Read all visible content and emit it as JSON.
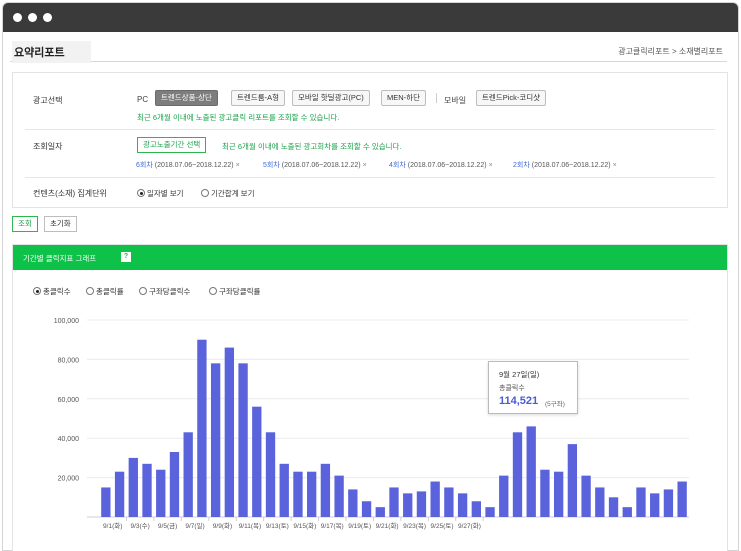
{
  "page": {
    "title": "요약리포트",
    "breadcrumb": "광고클릭리포트 > 소재별리포트"
  },
  "filters": {
    "ad_select": {
      "label": "광고선택",
      "platform_pc": "PC",
      "platform_mobile": "모바일",
      "pc_options": [
        "트렌드상품-상단",
        "트렌드룸-A형",
        "모바일 핫딜광고(PC)",
        "MEN-하단"
      ],
      "mobile_options": [
        "트렌드Pick-코디샷"
      ],
      "selected": "트렌드상품-상단",
      "note": "최근 6개월 이내에 노출된 광고클릭 리포트를 조회할 수 있습니다."
    },
    "period": {
      "label": "조회일자",
      "button": "광고노출기간 선택",
      "note": "최근 6개월 이내에 노출된 광고회차를 조회할 수 있습니다.",
      "items": [
        {
          "round": "6회차",
          "range": "(2018.07.06~2018.12.22)"
        },
        {
          "round": "5회차",
          "range": "(2018.07.06~2018.12.22)"
        },
        {
          "round": "4회차",
          "range": "(2018.07.06~2018.12.22)"
        },
        {
          "round": "2회차",
          "range": "(2018.07.06~2018.12.22)"
        }
      ],
      "remove_icon": "×"
    },
    "aggregate": {
      "label": "컨텐츠(소재) 집계단위",
      "options": [
        "일자별 보기",
        "기간합계 보기"
      ],
      "selected": "일자별 보기"
    }
  },
  "actions": {
    "search": "조회",
    "reset": "초기화"
  },
  "chart_panel": {
    "title": "기간별 클릭지표 그래프",
    "help_icon": "?",
    "metrics": [
      "총클릭수",
      "총클릭률",
      "구좌당클릭수",
      "구좌당클릭률"
    ],
    "selected_metric": "총클릭수",
    "tooltip": {
      "date": "9월 27일(일)",
      "label": "총클릭수",
      "value": "114,521",
      "unit": "(5구좌)"
    }
  },
  "colors": {
    "accent_green": "#0dc149",
    "bar": "#5b63dc",
    "link_blue": "#3d6bd8"
  },
  "chart_data": {
    "type": "bar",
    "x_tick_labels": [
      "9/1(화)",
      "9/3(수)",
      "9/5(금)",
      "9/7(일)",
      "9/9(화)",
      "9/11(목)",
      "9/13(토)",
      "9/15(화)",
      "9/17(목)",
      "9/19(토)",
      "9/21(화)",
      "9/23(목)",
      "9/25(토)",
      "9/27(화)"
    ],
    "values": [
      15000,
      23000,
      30000,
      27000,
      24000,
      33000,
      43000,
      90000,
      78000,
      86000,
      78000,
      56000,
      43000,
      27000,
      23000,
      23000,
      27000,
      21000,
      14000,
      8000,
      5000,
      15000,
      12000,
      13000,
      18000,
      15000,
      12000,
      8000,
      5000,
      21000,
      43000,
      46000,
      24000,
      23000,
      37000,
      21000,
      15000,
      10000,
      5000,
      15000,
      12000,
      14000,
      18000
    ],
    "ylim": [
      0,
      100000
    ],
    "y_ticks": [
      20000,
      40000,
      60000,
      80000,
      100000
    ],
    "y_tick_labels": [
      "20,000",
      "40,000",
      "60,000",
      "80,000",
      "100,000"
    ],
    "grid": true,
    "legend": "none"
  }
}
